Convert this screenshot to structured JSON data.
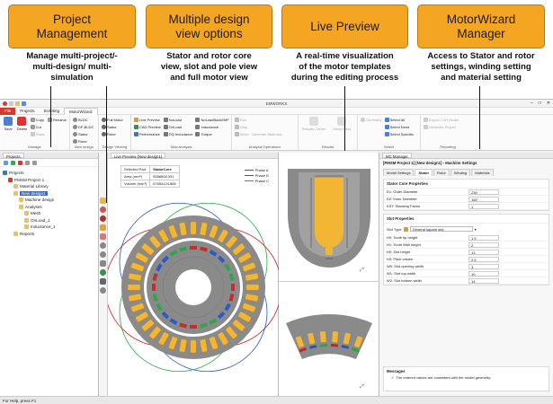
{
  "callouts": [
    {
      "title": "Project\nManagement",
      "desc": "Manage multi-project/-\nmulti-design/ multi-\nsimulation"
    },
    {
      "title": "Multiple design\nview options",
      "desc": "Stator and rotor core\nview, slot and pole view\nand full motor view"
    },
    {
      "title": "Live Preview",
      "desc": "A real-time visualization\nof the motor templates\nduring the editing process"
    },
    {
      "title": "MotorWizard\nManager",
      "desc": "Access to Stator and rotor\nsettings, winding setting\nand material setting"
    }
  ],
  "app": {
    "title": "EMWORKS",
    "menu": [
      "File",
      "Projects",
      "Scripting",
      "MotorWizard"
    ],
    "ribbon": {
      "manage": {
        "label": "Manage",
        "save": "Save",
        "delete": "Delete",
        "copy": "Copy",
        "cut": "Cut",
        "paste": "Paste",
        "rename": "Rename"
      },
      "new_design": {
        "label": "New design",
        "items": [
          "BLDC",
          "DF-BLDC",
          "Stator",
          "Rotor"
        ]
      },
      "design_viewing": {
        "label": "Design Viewing",
        "items": [
          "Full Motor",
          "Stator",
          "Rotor"
        ]
      },
      "new_analysis": {
        "label": "New Analysis",
        "items": [
          "Live Preview",
          "CAD Preview",
          "Performance",
          "NoLoad",
          "OnLoad",
          "DQ Inductance",
          "NoLoadBackEMF",
          "Inductance",
          "Torque"
        ]
      },
      "analysis_ops": {
        "label": "Analysis Operations",
        "items": [
          "Run",
          "Stop",
          "Mesh",
          "Generate Materials"
        ]
      },
      "results": {
        "label": "Results",
        "items": [
          "Results Center",
          "Show Field"
        ]
      },
      "select": {
        "label": "Select",
        "items": [
          "Geometry",
          "Select All",
          "Select None",
          "Select Specific"
        ]
      },
      "reporting": {
        "label": "Reporting",
        "items": [
          "Export CAD Model",
          "Generate Report"
        ]
      }
    },
    "projects_panel": {
      "tab": "Projects",
      "tree": [
        {
          "label": "Projects",
          "level": 0
        },
        {
          "label": "PMSM Project 1",
          "level": 1
        },
        {
          "label": "Material Library",
          "level": 2
        },
        {
          "label": "New design1",
          "level": 2,
          "selected": true
        },
        {
          "label": "Machine design",
          "level": 3
        },
        {
          "label": "Analyses",
          "level": 3
        },
        {
          "label": "Mesh",
          "level": 4
        },
        {
          "label": "OnLoad_1",
          "level": 4
        },
        {
          "label": "Inductance_1",
          "level": 4
        },
        {
          "label": "Reports",
          "level": 2
        }
      ]
    },
    "live_preview": {
      "tab": "Live Preview (New design1)",
      "table": [
        [
          "Selected Part",
          "StatorCore"
        ],
        [
          "Area (mm²)",
          "5558608.331"
        ],
        [
          "Volume (mm³)",
          "57654124.885"
        ]
      ],
      "legend": [
        {
          "name": "Phase A",
          "color": "#cc2222"
        },
        {
          "name": "Phase B",
          "color": "#2255cc"
        },
        {
          "name": "Phase C",
          "color": "#22aa44"
        }
      ]
    },
    "manager": {
      "tab": "MC Manager",
      "header": "[PMSM Project 1] [New design1] - Machine Settings",
      "tabs": [
        "Model Settings",
        "Stator",
        "Rotor",
        "Winding",
        "Materials"
      ],
      "active_tab": "Stator",
      "core_title": "Stator Core Properties",
      "core": [
        {
          "label": "D1: Outer Diameter",
          "value": "230"
        },
        {
          "label": "D2: Inner Diameter",
          "value": "160"
        },
        {
          "label": "KST: Stacking Factor",
          "value": "1"
        }
      ],
      "slot_title": "Slot Properties",
      "slot_type_label": "Slot Type",
      "slot_type": "General square slot",
      "slot": [
        {
          "label": "H0: Tooth tip height",
          "value": "1.5"
        },
        {
          "label": "H1: Tooth Wall height",
          "value": "2"
        },
        {
          "label": "H2: Slot height",
          "value": "13"
        },
        {
          "label": "H3: Pitch values",
          "value": "2.5"
        },
        {
          "label": "W0: Slot opening width",
          "value": "3"
        },
        {
          "label": "W1: Slot top width",
          "value": "10"
        },
        {
          "label": "W2: Slot bottom width",
          "value": "14"
        }
      ],
      "messages_title": "Messages",
      "message": "The entered values are consistent with the model geometry."
    },
    "status": "For Help, press F1"
  },
  "colors": {
    "accent": "#f4a623",
    "file": "#d7382c",
    "copper": "#e8b04a",
    "core": "#8a8a8a"
  }
}
